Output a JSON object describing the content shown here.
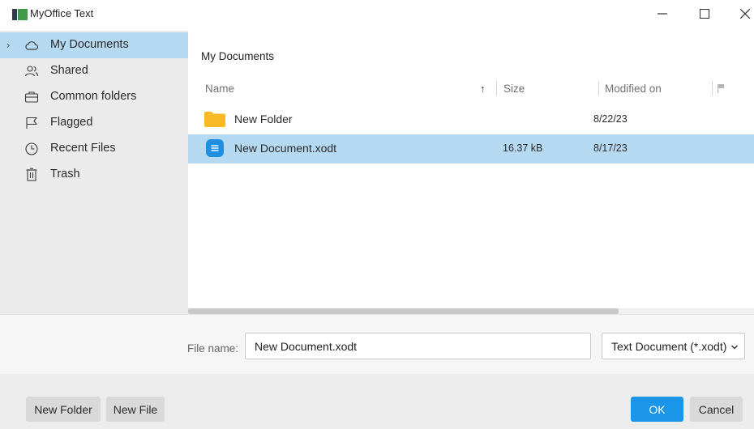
{
  "window": {
    "title": "MyOffice Text",
    "minimize_glyph": "─",
    "maximize_glyph": "☐",
    "close_glyph": "✕"
  },
  "sidebar": {
    "items": [
      {
        "label": "My Documents",
        "icon": "cloud-icon",
        "selected": true,
        "expand_glyph": "›"
      },
      {
        "label": "Shared",
        "icon": "people-icon",
        "selected": false
      },
      {
        "label": "Common folders",
        "icon": "briefcase-icon",
        "selected": false
      },
      {
        "label": "Flagged",
        "icon": "flag-icon",
        "selected": false
      },
      {
        "label": "Recent Files",
        "icon": "clock-icon",
        "selected": false
      },
      {
        "label": "Trash",
        "icon": "trash-icon",
        "selected": false
      }
    ]
  },
  "main": {
    "location": "My Documents",
    "columns": {
      "name": "Name",
      "sort_glyph": "↑",
      "size": "Size",
      "modified": "Modified on",
      "flag_icon": "flag-icon"
    },
    "rows": [
      {
        "name": "New Folder",
        "size": "",
        "modified": "8/22/23",
        "type": "folder",
        "icon": "folder-icon",
        "selected": false
      },
      {
        "name": "New Document.xodt",
        "size": "16.37 kB",
        "modified": "8/17/23",
        "type": "document",
        "icon": "document-icon",
        "selected": true
      }
    ]
  },
  "file_name": {
    "label": "File name:",
    "value": "New Document.xodt",
    "file_type": "Text Document (*.xodt)",
    "dropdown_glyph": "⌄"
  },
  "buttons": {
    "new_folder": "New Folder",
    "new_file": "New File",
    "ok": "OK",
    "cancel": "Cancel"
  },
  "colors": {
    "selection": "#b5d9f1",
    "sidebar_bg": "#ebebeb",
    "primary": "#1b95e8",
    "folder": "#f7b924",
    "document": "#1e8fe0"
  }
}
